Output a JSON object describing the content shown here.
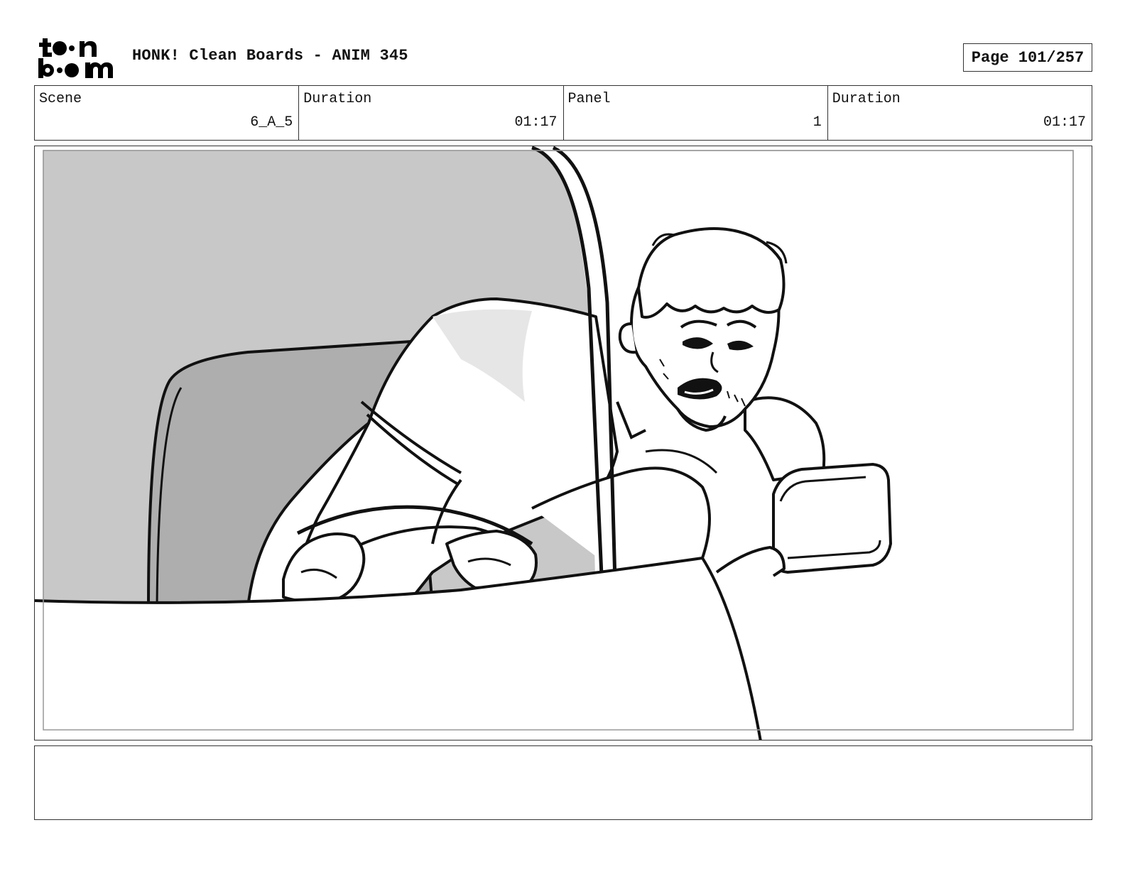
{
  "header": {
    "logo_text": "toon boom",
    "title": "HONK! Clean Boards - ANIM 345",
    "page_label": "Page 101/257"
  },
  "info": [
    {
      "label": "Scene",
      "value": "6_A_5"
    },
    {
      "label": "Duration",
      "value": "01:17"
    },
    {
      "label": "Panel",
      "value": "1"
    },
    {
      "label": "Duration",
      "value": "01:17"
    }
  ],
  "notes": {
    "text": ""
  }
}
